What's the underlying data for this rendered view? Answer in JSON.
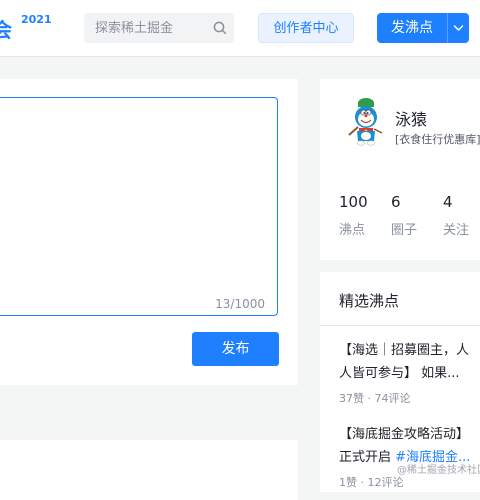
{
  "header": {
    "logo_text": "会",
    "logo_year": "2021",
    "search_placeholder": "探索稀土掘金",
    "creator_center": "创作者中心",
    "publish_label": "发沸点"
  },
  "editor": {
    "counter": "13/1000",
    "submit_label": "发布"
  },
  "profile": {
    "name": "泳猿",
    "bio": "[衣食住行优惠库]",
    "stats": [
      {
        "value": "100",
        "label": "沸点"
      },
      {
        "value": "6",
        "label": "圈子"
      },
      {
        "value": "4",
        "label": "关注"
      }
    ]
  },
  "hot_pins": {
    "title": "精选沸点",
    "items": [
      {
        "text": "【海选｜招募圈主，人人皆可参与】 如果...",
        "tag": "",
        "meta": "37赞 · 74评论"
      },
      {
        "text": "【海底掘金攻略活动】正式开启 ",
        "tag": "#海底掘金...",
        "meta": "1赞 · 12评论"
      }
    ]
  },
  "watermark": "@稀土掘金技术社区",
  "colors": {
    "accent": "#1e80ff",
    "background": "#f4f5f5"
  }
}
